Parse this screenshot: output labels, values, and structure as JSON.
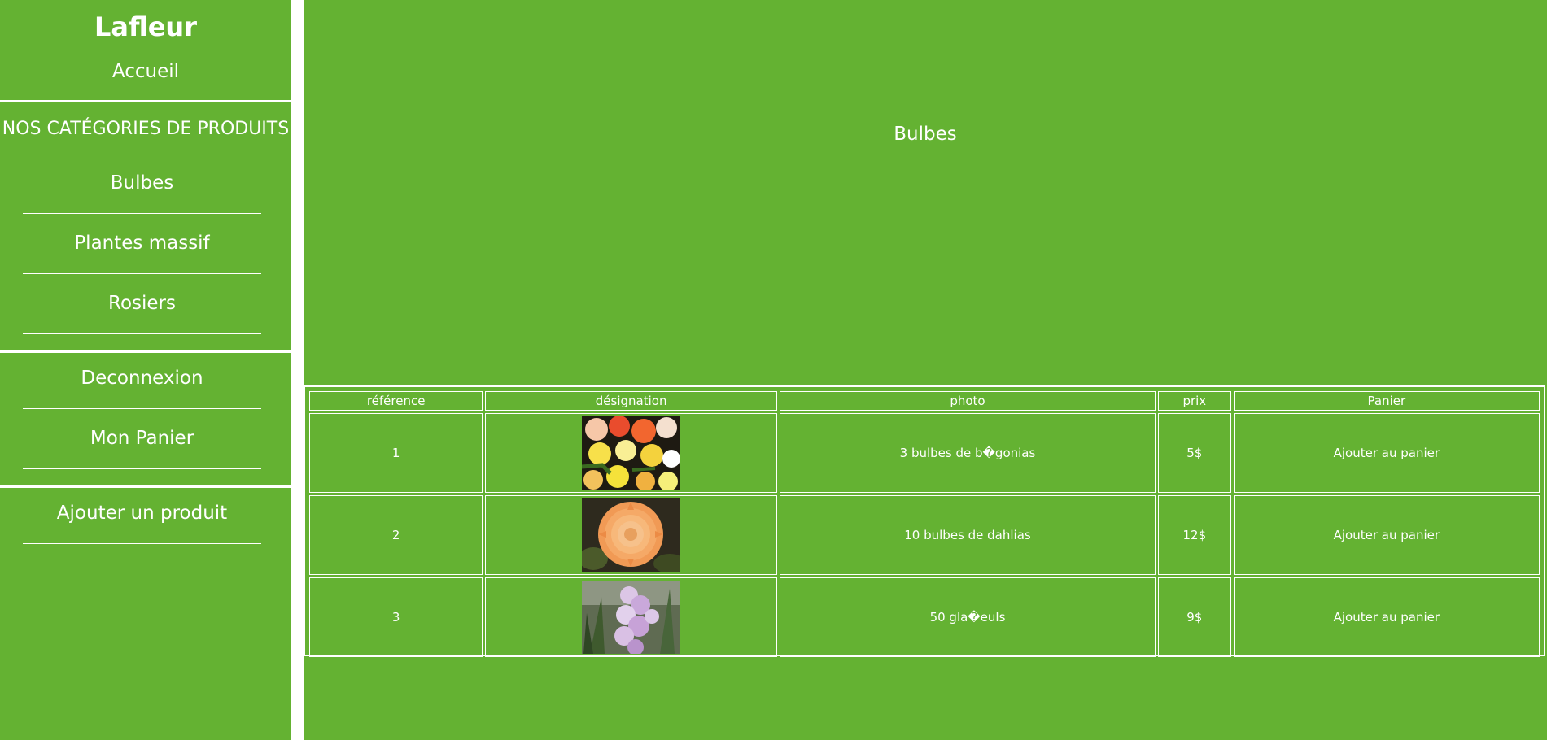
{
  "sidebar": {
    "brand": "Lafleur",
    "home": "Accueil",
    "categories_heading": "NOS CATÉGORIES DE PRODUITS",
    "categories": [
      "Bulbes",
      "Plantes massif",
      "Rosiers"
    ],
    "account": [
      "Deconnexion",
      "Mon Panier"
    ],
    "admin": [
      "Ajouter un produit"
    ]
  },
  "main": {
    "title": "Bulbes",
    "table": {
      "headers": [
        "référence",
        "désignation",
        "photo",
        "prix",
        "Panier"
      ],
      "rows": [
        {
          "ref": "1",
          "image": "begonias-photo",
          "designation": "3 bulbes de b�gonias",
          "price": "5$",
          "action": "Ajouter au panier"
        },
        {
          "ref": "2",
          "image": "dahlia-photo",
          "designation": "10 bulbes de dahlias",
          "price": "12$",
          "action": "Ajouter au panier"
        },
        {
          "ref": "3",
          "image": "gladiolus-photo",
          "designation": "50 gla�euls",
          "price": "9$",
          "action": "Ajouter au panier"
        }
      ]
    }
  },
  "colors": {
    "green": "#64b232",
    "white": "#ffffff"
  }
}
